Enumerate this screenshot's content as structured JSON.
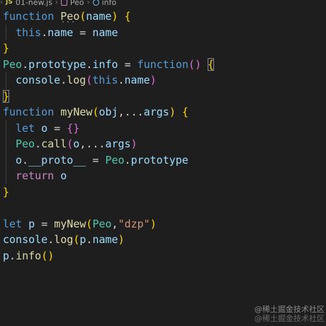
{
  "breadcrumb": {
    "file_icon": "JS",
    "file": "01-new.js",
    "separator": "›",
    "symbol": "Peo",
    "member": "info"
  },
  "code_lines": [
    "function Peo(name) {",
    "  this.name = name",
    "}",
    "Peo.prototype.info = function() {",
    "  console.log(this.name)",
    "}",
    "function myNew(obj,...args) {",
    "  let o = {}",
    "  Peo.call(o,...args)",
    "  o.__proto__ = Peo.prototype",
    "  return o",
    "}",
    "",
    "let p = myNew(Peo,\"dzp\")",
    "console.log(p.name)",
    "p.info()"
  ],
  "tokens": {
    "function": "function",
    "Peo": "Peo",
    "name": "name",
    "this": "this",
    "prototype": "prototype",
    "info": "info",
    "console": "console",
    "log": "log",
    "myNew": "myNew",
    "obj": "obj",
    "args": "args",
    "let": "let",
    "o": "o",
    "call": "call",
    "proto": "__proto__",
    "return": "return",
    "p": "p",
    "dzp": "\"dzp\"",
    "spread": "...",
    "assign": " = ",
    "dot": ".",
    "comma": ",",
    "lparen": "(",
    "rparen": ")",
    "lbrace": "{",
    "rbrace": "}",
    "space": " "
  },
  "hover_dots": "···",
  "watermark": {
    "line1": "@稀土掘金技术社区",
    "line2": "@稀土掘金技术社区"
  },
  "colors": {
    "background": "#1e1e1e",
    "keyword": "#569cd6",
    "function": "#dcdcaa",
    "class": "#4ec9b0",
    "variable": "#9cdcfe",
    "string": "#ce9178",
    "control": "#c586c0"
  }
}
